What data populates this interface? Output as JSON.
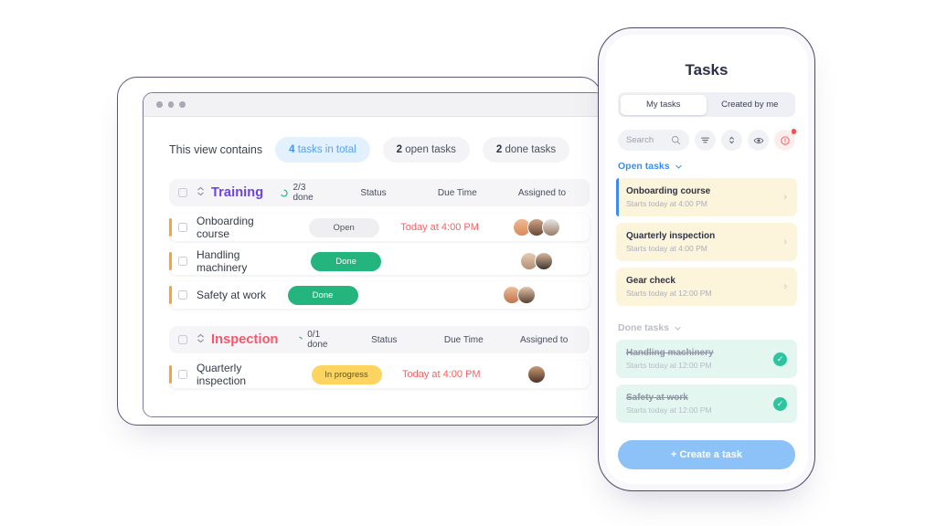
{
  "desktop": {
    "window_dots": [
      "dot-1",
      "dot-2",
      "dot-3"
    ],
    "summary": {
      "label": "This view contains",
      "pills": [
        {
          "count": "4",
          "text": " tasks in total",
          "style": "blue"
        },
        {
          "count": "2",
          "text": " open tasks",
          "style": "gray"
        },
        {
          "count": "2",
          "text": " done tasks",
          "style": "gray"
        }
      ]
    },
    "columns": {
      "status": "Status",
      "due": "Due Time",
      "assigned": "Assigned to"
    },
    "groups": [
      {
        "title": "Training",
        "color": "#6b41e8",
        "progress": "2/3 done",
        "rows": [
          {
            "name": "Onboarding course",
            "status": "Open",
            "status_style": "open",
            "due": "Today at 4:00 PM",
            "avatars": 3
          },
          {
            "name": "Handling machinery",
            "status": "Done",
            "status_style": "done",
            "due": "",
            "avatars": 2
          },
          {
            "name": "Safety at work",
            "status": "Done",
            "status_style": "done",
            "due": "",
            "avatars": 2
          }
        ]
      },
      {
        "title": "Inspection",
        "color": "#f9556d",
        "progress": "0/1 done",
        "rows": [
          {
            "name": "Quarterly inspection",
            "status": "In progress",
            "status_style": "prog",
            "due": "Today at 4:00 PM",
            "avatars": 1
          }
        ]
      }
    ]
  },
  "phone": {
    "title": "Tasks",
    "tabs": [
      {
        "label": "My tasks",
        "active": true
      },
      {
        "label": "Created by me",
        "active": false
      }
    ],
    "search_placeholder": "Search",
    "tools": [
      "filter-icon",
      "sort-icon",
      "eye-icon",
      "alert-icon"
    ],
    "sections": [
      {
        "label": "Open tasks",
        "style": "open",
        "cards": [
          {
            "title": "Onboarding course",
            "sub": "Starts today at 4:00 PM",
            "accent": true,
            "done": false
          },
          {
            "title": "Quarterly inspection",
            "sub": "Starts today at 4:00 PM",
            "accent": false,
            "done": false
          },
          {
            "title": "Gear check",
            "sub": "Starts today at 12:00 PM",
            "accent": false,
            "done": false
          }
        ]
      },
      {
        "label": "Done tasks",
        "style": "done",
        "cards": [
          {
            "title": "Handling machinery",
            "sub": "Starts today at 12:00 PM",
            "accent": false,
            "done": true
          },
          {
            "title": "Safety at work",
            "sub": "Starts today at 12:00 PM",
            "accent": false,
            "done": true
          }
        ]
      }
    ],
    "cta": "+ Create a task"
  },
  "colors": {
    "accent_blue": "#3b8ef0",
    "purple": "#6b41e8",
    "pink": "#f9556d",
    "green": "#24b47e",
    "yellow": "#fcd45f",
    "orange": "#fca13a",
    "red": "#fc5f62"
  }
}
